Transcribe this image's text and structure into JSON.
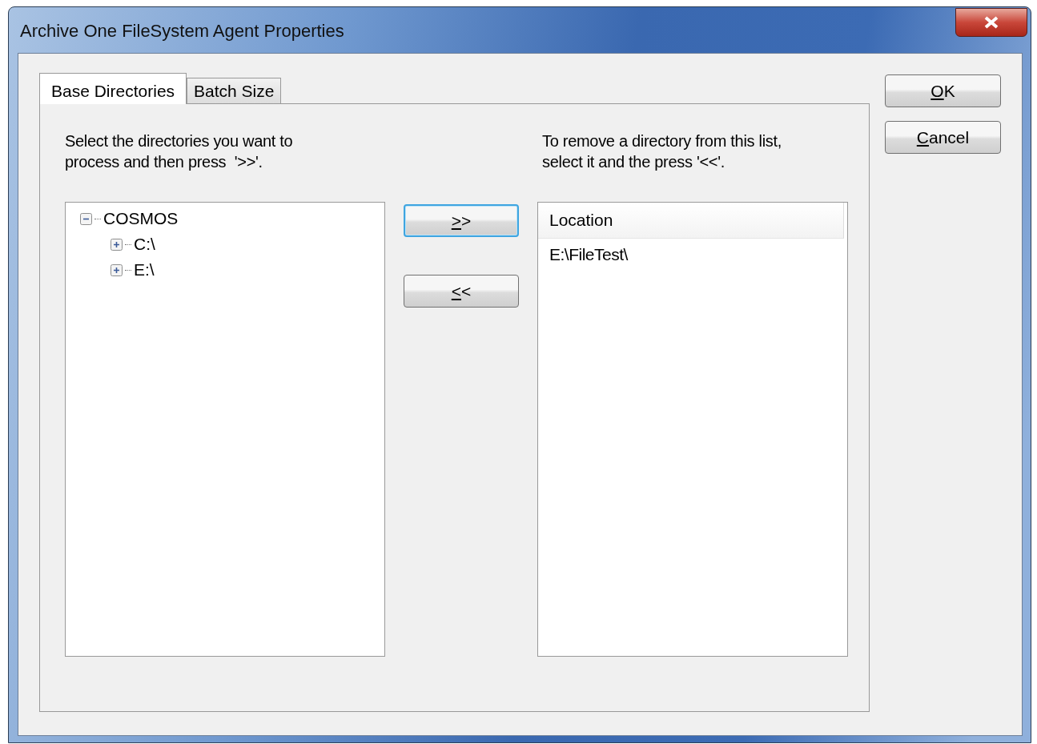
{
  "window": {
    "title": "Archive One FileSystem Agent Properties"
  },
  "tabs": [
    {
      "label": "Base Directories",
      "selected": true
    },
    {
      "label": "Batch Size",
      "selected": false
    }
  ],
  "left_instructions": "Select the directories you want to\nprocess and then press  '>>'.",
  "right_instructions": "To remove a directory from this list,\nselect it and the press '<<'.",
  "tree": [
    {
      "label": "COSMOS",
      "expanded": true,
      "children": [
        {
          "label": "C:\\",
          "expanded": false
        },
        {
          "label": "E:\\",
          "expanded": false
        }
      ]
    }
  ],
  "move_buttons": [
    {
      "label": ">>",
      "first_letter_underlined": true,
      "focused": true
    },
    {
      "label": "<<",
      "first_letter_underlined": true,
      "focused": false
    }
  ],
  "list": {
    "columns": [
      "Location"
    ],
    "rows": [
      "E:\\FileTest\\"
    ]
  },
  "dialog_buttons": [
    {
      "label": "OK",
      "first_letter_underlined": true
    },
    {
      "label": "Cancel",
      "first_letter_underlined": true
    }
  ]
}
